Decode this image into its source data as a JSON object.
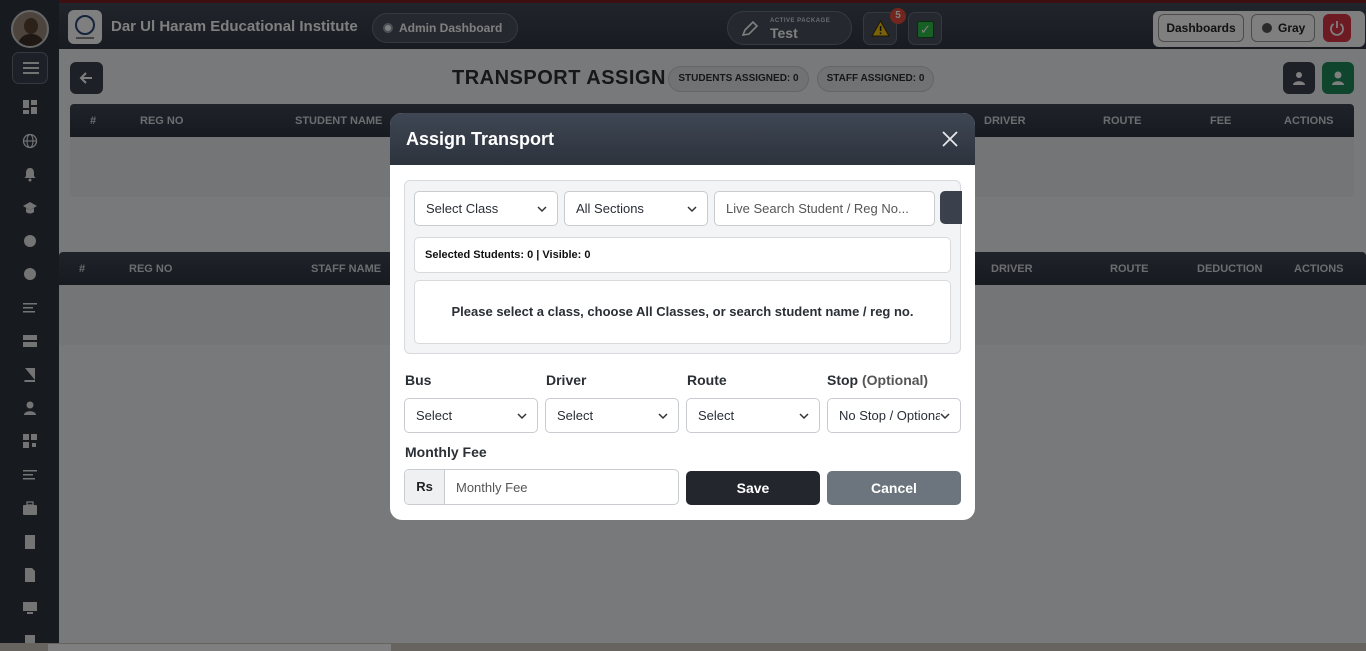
{
  "topbar": {
    "app_title": "Dar Ul Haram Educational Institute",
    "dashboard_pill": "Admin Dashboard",
    "package_label": "ACTIVE PACKAGE",
    "package_name": "Test",
    "alert_count": "5",
    "dashboards_button": "Dashboards",
    "theme_button": "Gray"
  },
  "sidebar": {
    "icons": [
      "dashboard-icon",
      "globe-icon",
      "bell-icon",
      "graduation-cap-icon",
      "circle-icon",
      "circle-icon",
      "list-icon",
      "layers-icon",
      "book-icon",
      "user-icon",
      "grid-icon",
      "list-icon",
      "briefcase-icon",
      "file-icon",
      "file-icon",
      "monitor-icon",
      "file-icon"
    ]
  },
  "page": {
    "title": "TRANSPORT ASSIGN",
    "students_assigned": "STUDENTS ASSIGNED: 0",
    "staff_assigned": "STAFF ASSIGNED: 0"
  },
  "student_table": {
    "headers": [
      "#",
      "REG NO",
      "STUDENT NAME",
      "DRIVER",
      "ROUTE",
      "FEE",
      "ACTIONS"
    ]
  },
  "staff_table": {
    "headers": [
      "#",
      "REG NO",
      "STAFF NAME",
      "DRIVER",
      "ROUTE",
      "DEDUCTION",
      "ACTIONS"
    ]
  },
  "modal": {
    "title": "Assign Transport",
    "class_select": "Select Class",
    "section_select": "All Sections",
    "search_placeholder": "Live Search Student / Reg No...",
    "selected_info": "Selected Students: 0 | Visible: 0",
    "empty_message": "Please select a class, choose All Classes, or search student name / reg no.",
    "bus_label": "Bus",
    "driver_label": "Driver",
    "route_label": "Route",
    "stop_label": "Stop",
    "stop_optional": "(Optional)",
    "bus_value": "Select",
    "driver_value": "Select",
    "route_value": "Select",
    "stop_value": "No Stop / Optional",
    "fee_label": "Monthly Fee",
    "currency": "Rs",
    "fee_placeholder": "Monthly Fee",
    "save": "Save",
    "cancel": "Cancel"
  }
}
